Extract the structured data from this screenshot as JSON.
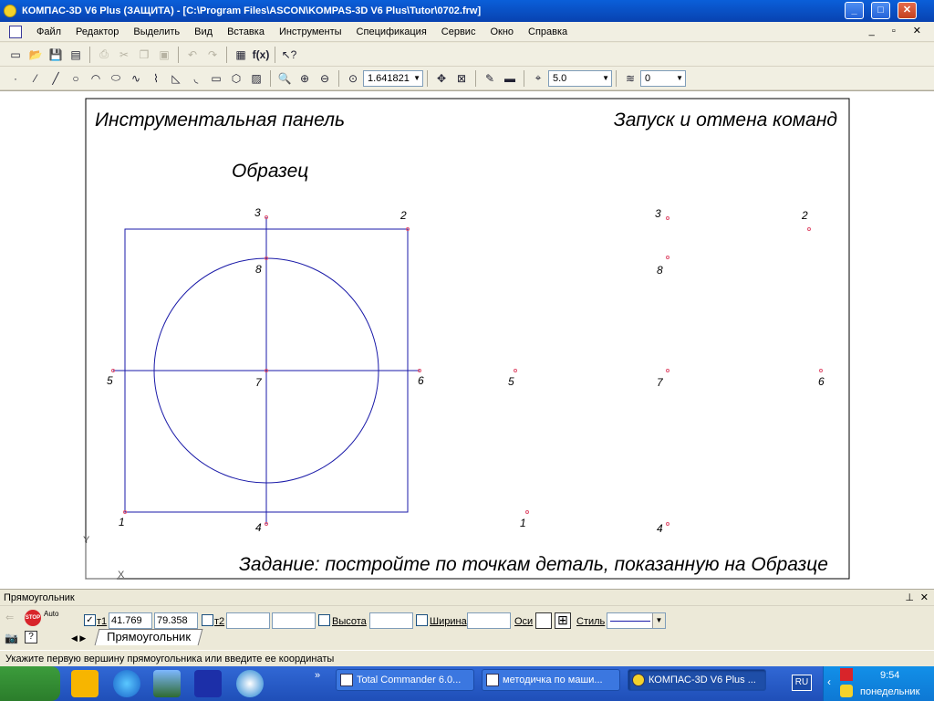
{
  "window": {
    "title": "КОМПАС-3D V6 Plus (ЗАЩИТА) - [C:\\Program Files\\ASCON\\KOMPAS-3D V6 Plus\\Tutor\\0702.frw]"
  },
  "menu": [
    "Файл",
    "Редактор",
    "Выделить",
    "Вид",
    "Вставка",
    "Инструменты",
    "Спецификация",
    "Сервис",
    "Окно",
    "Справка"
  ],
  "toolbar": {
    "zoom": "1.641821",
    "step": "5.0",
    "layer": "0"
  },
  "drawing": {
    "heading_left": "Инструментальная панель",
    "heading_right": "Запуск и отмена команд",
    "sample_label": "Образец",
    "task": "Задание: постройте по точкам деталь, показанную на Образце",
    "axis_x": "X",
    "axis_y": "Y",
    "sample_points": [
      "1",
      "2",
      "3",
      "4",
      "5",
      "6",
      "7",
      "8"
    ],
    "target_points": [
      "1",
      "2",
      "3",
      "4",
      "5",
      "6",
      "7",
      "8"
    ]
  },
  "props": {
    "panel_title": "Прямоугольник",
    "t1_label": "т1",
    "t1_x": "41.769",
    "t1_y": "79.358",
    "t2_label": "т2",
    "height_label": "Высота",
    "width_label": "Ширина",
    "axes_label": "Оси",
    "style_label": "Стиль",
    "tab_label": "Прямоугольник",
    "stop_label": "STOP",
    "auto_label": "Auto"
  },
  "status": "Укажите первую вершину прямоугольника или введите ее координаты",
  "taskbar": {
    "tasks": [
      "Total Commander 6.0...",
      "методичка по маши...",
      "КОМПАС-3D V6 Plus ..."
    ],
    "lang": "RU",
    "time": "9:54",
    "day": "понедельник"
  },
  "colors": {
    "geometry": "#1a1aa8",
    "points": "#e0506e",
    "titlebar": "#0a5fd9"
  }
}
